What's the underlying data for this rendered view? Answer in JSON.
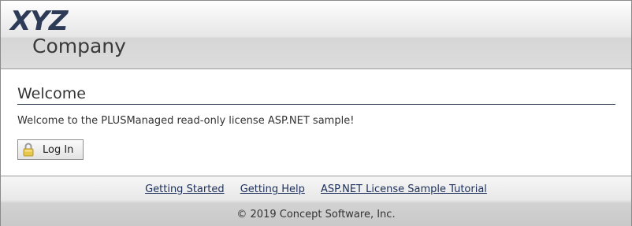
{
  "header": {
    "logo_brand": "XYZ",
    "logo_company": "Company"
  },
  "main": {
    "title": "Welcome",
    "message": "Welcome to the PLUSManaged read-only license ASP.NET sample!",
    "login_button": {
      "label": "Log In",
      "icon": "lock-icon"
    }
  },
  "footer": {
    "links": [
      "Getting Started",
      "Getting Help",
      "ASP.NET License Sample Tutorial"
    ],
    "copyright": "© 2019 Concept Software, Inc."
  },
  "colors": {
    "brand": "#2d3b57",
    "link": "#1c2f5a",
    "rule": "#2c3a52",
    "lock": "#e8c84a"
  }
}
